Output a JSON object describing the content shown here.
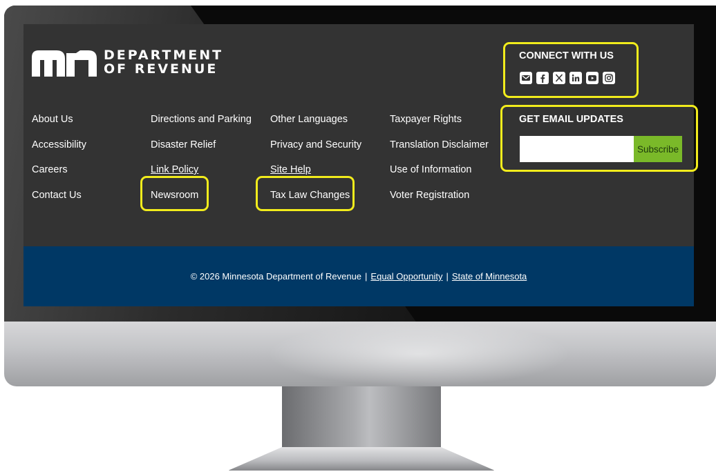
{
  "site": {
    "logo": {
      "line1": "DEPARTMENT",
      "line2": "OF REVENUE"
    }
  },
  "footer": {
    "columns": [
      {
        "links": [
          "About Us",
          "Accessibility",
          "Careers",
          "Contact Us"
        ]
      },
      {
        "links": [
          "Directions and Parking",
          "Disaster Relief",
          "Link Policy",
          "Newsroom"
        ]
      },
      {
        "links": [
          "Other Languages",
          "Privacy and Security",
          "Site Help",
          "Tax Law Changes"
        ]
      },
      {
        "links": [
          "Taxpayer Rights",
          "Translation Disclaimer",
          "Use of Information",
          "Voter Registration"
        ]
      }
    ]
  },
  "connect": {
    "title": "CONNECT WITH US",
    "icons": [
      "email-icon",
      "facebook-icon",
      "x-icon",
      "linkedin-icon",
      "youtube-icon",
      "instagram-icon"
    ]
  },
  "email_updates": {
    "title": "GET EMAIL UPDATES",
    "input_value": "",
    "button_label": "Subscribe"
  },
  "bottom_bar": {
    "copyright": "© 2026 Minnesota Department of Revenue",
    "separator": "|",
    "link_equal_opportunity": "Equal Opportunity",
    "link_state": "State of Minnesota"
  },
  "colors": {
    "footer_bg": "#333333",
    "bottom_bar_bg": "#003865",
    "subscribe_bg": "#7ab929",
    "callout": "#f2ec1c"
  }
}
